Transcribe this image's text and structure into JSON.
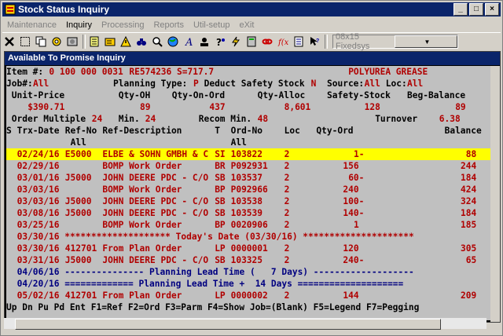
{
  "window": {
    "title": "Stock Status Inquiry",
    "min_label": "_",
    "max_label": "□",
    "close_label": "×"
  },
  "menu": [
    {
      "label": "Maintenance",
      "enabled": false
    },
    {
      "label": "Inquiry",
      "enabled": true
    },
    {
      "label": "Processing",
      "enabled": false
    },
    {
      "label": "Reports",
      "enabled": false
    },
    {
      "label": "Util-setup",
      "enabled": false
    },
    {
      "label": "eXit",
      "enabled": false
    }
  ],
  "toolbar": {
    "font_select": "08x15 Fixedsys"
  },
  "panel": {
    "title": "Available To Promise Inquiry"
  },
  "header": {
    "item_label": "Item #:",
    "item_value": "0 100 000 0031",
    "re_value": "RE574236 S=717.7",
    "desc": "POLYUREA GREASE",
    "job_label": "Job#:",
    "job_value": "All",
    "plan_label": "Planning Type:",
    "plan_value": "P",
    "deduct_label": "Deduct Safety Stock",
    "deduct_value": "N",
    "source_label": "Source:",
    "source_value": "All",
    "loc_label": "Loc:",
    "loc_value": "All",
    "col1": "Unit-Price",
    "col2": "Qty-OH",
    "col3": "Qty-On-Ord",
    "col4": "Qty-Alloc",
    "col5": "Safety-Stock",
    "col6": "Beg-Balance",
    "v1": "$390.71",
    "v2": "89",
    "v3": "437",
    "v4": "8,601",
    "v5": "128",
    "v6": "89",
    "om_label": "Order Multiple",
    "om_value": "24",
    "min_label": "Min.",
    "min_value": "24",
    "recom_label": "Recom Min.",
    "recom_value": "48",
    "turn_label": "Turnover",
    "turn_value": "6.38"
  },
  "columns": {
    "s": "S",
    "trx": "Trx-Date",
    "ref": "Ref-No",
    "refall": "All",
    "desc": "Ref-Description",
    "t": "T",
    "ord": "Ord-No",
    "ordall": "All",
    "loc": "Loc",
    "qty": "Qty-Ord",
    "bal": "Balance"
  },
  "rows": [
    {
      "date": "02/24/16",
      "ref": "E5000",
      "desc": "ELBE & SOHN GMBH & C",
      "t": "SI",
      "ord": "103822",
      "loc": "2",
      "qty": "1-",
      "bal": "88",
      "hl": true
    },
    {
      "date": "02/29/16",
      "ref": "",
      "desc": "BOMP Work Order",
      "t": "BR",
      "ord": "P092931",
      "loc": "2",
      "qty": "156",
      "bal": "244"
    },
    {
      "date": "03/01/16",
      "ref": "J5000",
      "desc": "JOHN DEERE PDC - C/O",
      "t": "SB",
      "ord": "103537",
      "loc": "2",
      "qty": "60-",
      "bal": "184"
    },
    {
      "date": "03/03/16",
      "ref": "",
      "desc": "BOMP Work Order",
      "t": "BP",
      "ord": "P092966",
      "loc": "2",
      "qty": "240",
      "bal": "424"
    },
    {
      "date": "03/03/16",
      "ref": "J5000",
      "desc": "JOHN DEERE PDC - C/O",
      "t": "SB",
      "ord": "103538",
      "loc": "2",
      "qty": "100-",
      "bal": "324"
    },
    {
      "date": "03/08/16",
      "ref": "J5000",
      "desc": "JOHN DEERE PDC - C/O",
      "t": "SB",
      "ord": "103539",
      "loc": "2",
      "qty": "140-",
      "bal": "184"
    },
    {
      "date": "03/25/16",
      "ref": "",
      "desc": "BOMP Work Order",
      "t": "BP",
      "ord": "0020906",
      "loc": "2",
      "qty": "1",
      "bal": "185"
    }
  ],
  "today_line": "03/30/16 ******************** Today's Date (03/30/16) *********************",
  "rows2": [
    {
      "date": "03/30/16",
      "ref": "412701",
      "desc": "From Plan Order",
      "t": "LP",
      "ord": "0000001",
      "loc": "2",
      "qty": "120",
      "bal": "305"
    },
    {
      "date": "03/31/16",
      "ref": "J5000",
      "desc": "JOHN DEERE PDC - C/O",
      "t": "SB",
      "ord": "103325",
      "loc": "2",
      "qty": "240-",
      "bal": "65"
    }
  ],
  "lead1": "04/06/16 --------------- Planning Lead Time (   7 Days) -------------------",
  "lead2": "04/20/16 ============= Planning Lead Time +  14 Days ====================",
  "rows3": [
    {
      "date": "05/02/16",
      "ref": "412701",
      "desc": "From Plan Order",
      "t": "LP",
      "ord": "0000002",
      "loc": "2",
      "qty": "144",
      "bal": "209"
    }
  ],
  "status": "Up Dn Pu Pd Ent F1=Ref F2=Ord F3=Parm F4=Show Job=(Blank) F5=Legend F7=Pegging"
}
